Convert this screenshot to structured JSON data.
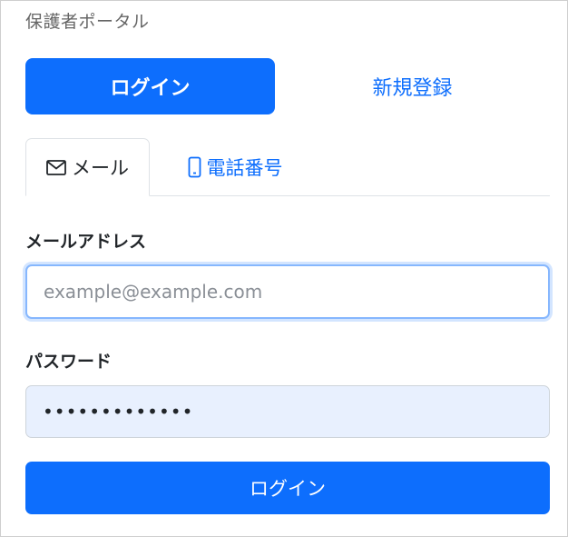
{
  "portal_title": "保護者ポータル",
  "mode_switch": {
    "login_label": "ログイン",
    "register_label": "新規登録"
  },
  "tabs": {
    "email_label": "メール",
    "email_icon": "envelope-icon",
    "phone_label": "電話番号",
    "phone_icon": "phone-icon"
  },
  "form": {
    "email_label": "メールアドレス",
    "email_placeholder": "example@example.com",
    "email_value": "",
    "password_label": "パスワード",
    "password_value": "•••••••••••••"
  },
  "submit_label": "ログイン",
  "colors": {
    "primary": "#0d6efd",
    "autofill_bg": "#e8f0fe",
    "focus_border": "#86b7fe"
  }
}
